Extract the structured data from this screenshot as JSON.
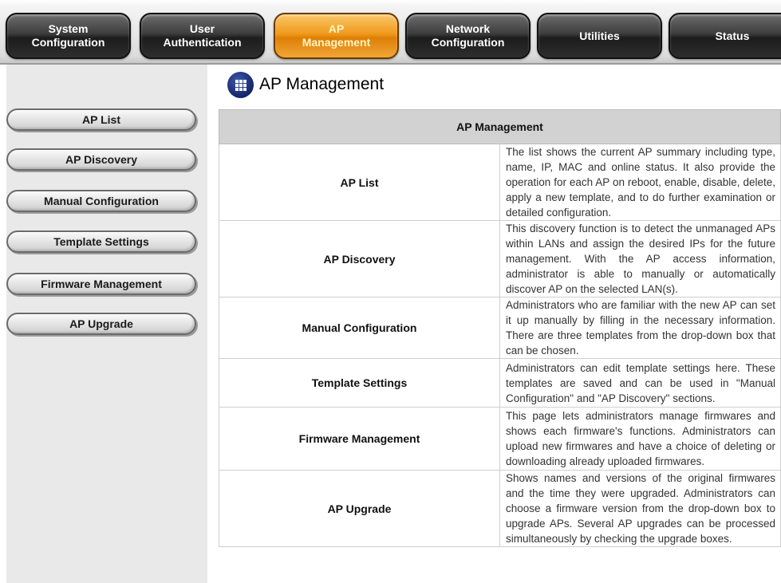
{
  "top_tabs": [
    {
      "line1": "System",
      "line2": "Configuration",
      "active": false
    },
    {
      "line1": "User",
      "line2": "Authentication",
      "active": false
    },
    {
      "line1": "AP",
      "line2": "Management",
      "active": true
    },
    {
      "line1": "Network",
      "line2": "Configuration",
      "active": false
    },
    {
      "line1": "Utilities",
      "line2": "",
      "active": false
    },
    {
      "line1": "Status",
      "line2": "",
      "active": false
    }
  ],
  "sidebar": {
    "items": [
      {
        "label": "AP List"
      },
      {
        "label": "AP Discovery"
      },
      {
        "label": "Manual Configuration"
      },
      {
        "label": "Template Settings"
      },
      {
        "label": "Firmware Management"
      },
      {
        "label": "AP Upgrade"
      }
    ]
  },
  "page": {
    "title": "AP Management",
    "title_icon": "grid-icon"
  },
  "table": {
    "header": "AP Management",
    "rows": [
      {
        "name": "AP List",
        "desc": "The list shows the current AP summary including type, name, IP, MAC and online status. It also provide the operation for each AP on reboot, enable, disable, delete, apply a new template, and to do further examination or detailed configuration."
      },
      {
        "name": "AP Discovery",
        "desc": "This discovery function is to detect the unmanaged APs within LANs and assign the desired IPs for the future management. With the AP access information, administrator is able to manually or automatically discover AP on the selected LAN(s)."
      },
      {
        "name": "Manual Configuration",
        "desc": "Administrators who are familiar with the new AP can set it up manually by filling in the necessary information. There are three templates from the drop-down box that can be chosen."
      },
      {
        "name": "Template Settings",
        "desc": "Administrators can edit template settings here. These templates are saved and can be used in \"Manual Configuration\" and \"AP Discovery\" sections."
      },
      {
        "name": "Firmware Management",
        "desc": "This page lets administrators manage firmwares and shows each firmware's functions. Administrators can upload new firmwares and have a choice of deleting or downloading already uploaded firmwares."
      },
      {
        "name": "AP Upgrade",
        "desc": "Shows names and versions of the original firmwares and the time they were upgraded. Administrators can choose a firmware version from the drop-down box to upgrade APs. Several AP upgrades can be processed simultaneously by checking the upgrade boxes."
      }
    ]
  },
  "bottom_nav": [
    {
      "icon": "home-icon"
    },
    {
      "icon": "arrow-up-icon"
    }
  ],
  "colors": {
    "active_tab": "#f09a1d",
    "inactive_tab": "#2e2e2e",
    "sidebar_bg": "#e9e9e9",
    "table_header_bg": "#d2d2d2",
    "title_icon": "#14246a",
    "nav_icon": "#1669b8"
  }
}
